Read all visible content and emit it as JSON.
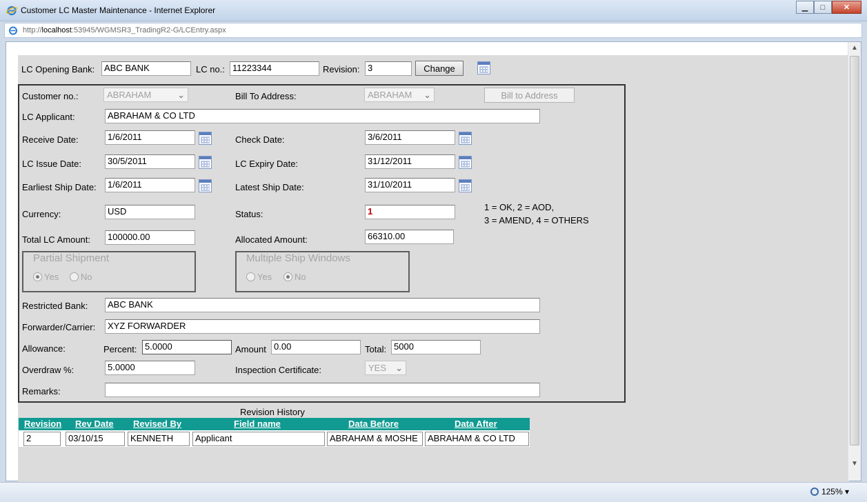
{
  "window": {
    "title": "Customer LC Master Maintenance - Internet Explorer",
    "url_prefix": "http://",
    "url_host": "localhost",
    "url_rest": ":53945/WGMSR3_TradingR2-G/LCEntry.aspx",
    "zoom": "125%"
  },
  "header": {
    "opening_bank_label": "LC Opening Bank:",
    "opening_bank_value": "ABC BANK",
    "lc_no_label": "LC no.:",
    "lc_no_value": "11223344",
    "revision_label": "Revision:",
    "revision_value": "3",
    "change_button": "Change"
  },
  "form": {
    "customer_no_label": "Customer no.:",
    "customer_no_value": "ABRAHAM",
    "bill_to_label": "Bill To Address:",
    "bill_to_value": "ABRAHAM",
    "bill_to_button": "Bill to Address",
    "applicant_label": "LC Applicant:",
    "applicant_value": "ABRAHAM & CO LTD",
    "receive_date_label": "Receive Date:",
    "receive_date_value": "1/6/2011",
    "check_date_label": "Check Date:",
    "check_date_value": "3/6/2011",
    "issue_date_label": "LC Issue Date:",
    "issue_date_value": "30/5/2011",
    "expiry_date_label": "LC Expiry Date:",
    "expiry_date_value": "31/12/2011",
    "earliest_ship_label": "Earliest Ship Date:",
    "earliest_ship_value": "1/6/2011",
    "latest_ship_label": "Latest Ship Date:",
    "latest_ship_value": "31/10/2011",
    "currency_label": "Currency:",
    "currency_value": "USD",
    "status_label": "Status:",
    "status_value": "1",
    "status_hint_1": "1 = OK, 2 = AOD,",
    "status_hint_2": "3 = AMEND, 4 = OTHERS",
    "total_amount_label": "Total LC Amount:",
    "total_amount_value": "100000.00",
    "allocated_label": "Allocated Amount:",
    "allocated_value": "66310.00",
    "partial_shipment_title": "Partial Shipment",
    "partial_yes": "Yes",
    "partial_no": "No",
    "partial_selected": "Yes",
    "multi_ship_title": "Multiple Ship Windows",
    "multi_yes": "Yes",
    "multi_no": "No",
    "multi_selected": "No",
    "restricted_bank_label": "Restricted Bank:",
    "restricted_bank_value": "ABC BANK",
    "forwarder_label": "Forwarder/Carrier:",
    "forwarder_value": "XYZ FORWARDER",
    "allowance_label": "Allowance:",
    "percent_label": "Percent:",
    "percent_value": "5.0000",
    "amount_label": "Amount",
    "amount_value": "0.00",
    "total_label": "Total:",
    "total_value": "5000",
    "overdraw_label": "Overdraw %:",
    "overdraw_value": "5.0000",
    "inspection_label": "Inspection Certificate:",
    "inspection_value": "YES",
    "remarks_label": "Remarks:",
    "remarks_value": ""
  },
  "revision_history": {
    "title": "Revision History",
    "columns": [
      "Revision",
      "Rev Date",
      "Revised By",
      "Field name",
      "Data Before",
      "Data After"
    ],
    "rows": [
      [
        "2",
        "03/10/15",
        "KENNETH",
        "Applicant",
        "ABRAHAM & MOSHE",
        "ABRAHAM & CO LTD"
      ]
    ]
  }
}
